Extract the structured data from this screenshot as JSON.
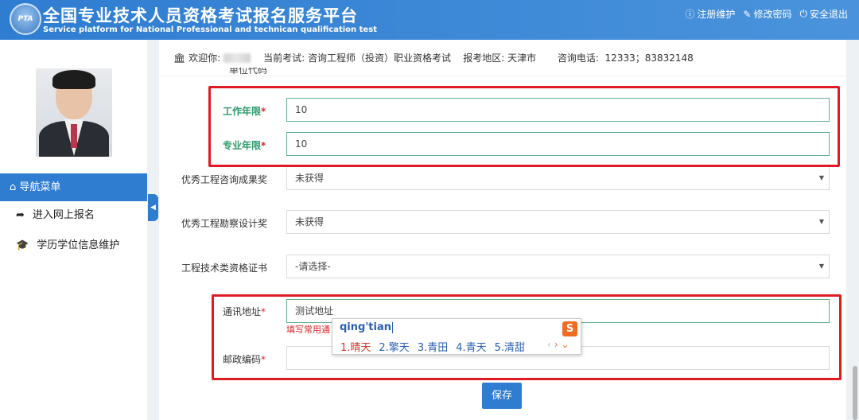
{
  "header": {
    "logo_text": "PTA",
    "title": "全国专业技术人员资格考试报名服务平台",
    "subtitle": "Service platform for National Professional and technican qualification test",
    "links": [
      "注册维护",
      "修改密码",
      "安全退出"
    ]
  },
  "sidebar": {
    "nav_title": "导航菜单",
    "items": [
      {
        "label": "进入网上报名",
        "icon": "share-arrow-icon"
      },
      {
        "label": "学历学位信息维护",
        "icon": "graduation-cap-icon"
      }
    ]
  },
  "infobar": {
    "welcome_label": "欢迎你:",
    "exam_label": "当前考试:",
    "exam_value": "咨询工程师（投资）职业资格考试",
    "region_label": "报考地区:",
    "region_value": "天津市",
    "phone_label": "咨询电话:",
    "phone_value": "12333；83832148"
  },
  "form": {
    "cut_label": "单位代码",
    "work_years_label": "工作年限",
    "work_years_value": "10",
    "pro_years_label": "专业年限",
    "pro_years_value": "10",
    "award_consult_label": "优秀工程咨询成果奖",
    "award_consult_value": "未获得",
    "award_survey_label": "优秀工程勘察设计奖",
    "award_survey_value": "未获得",
    "cert_label": "工程技术类资格证书",
    "cert_value": "-请选择-",
    "address_label": "通讯地址",
    "address_value": "测试地址",
    "address_hint": "填写常用通",
    "zip_label": "邮政编码",
    "zip_value": "",
    "required_mark": "*",
    "save_label": "保存"
  },
  "ime": {
    "composition": "qing'tian",
    "logo": "S",
    "candidates": [
      "1.晴天",
      "2.擎天",
      "3.青田",
      "4.青天",
      "5.清甜"
    ],
    "prev": "‹",
    "next": "›",
    "expand": "⌄"
  },
  "colors": {
    "header_blue": "#2f7dd1",
    "required_red": "#e02525",
    "label_green": "#2e9a6b",
    "highlight_red": "#e01b24"
  }
}
